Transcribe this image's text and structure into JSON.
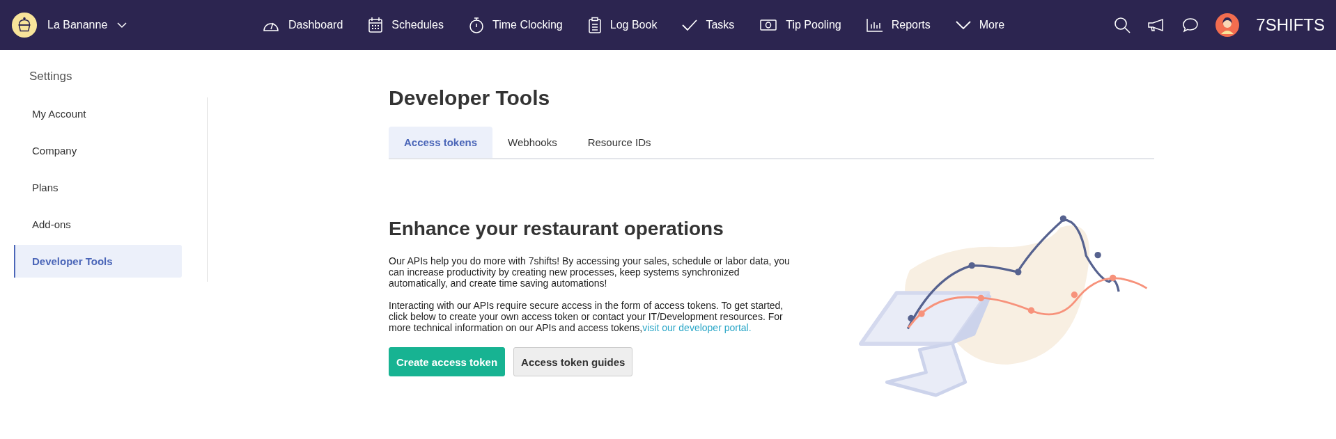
{
  "top_bar": {
    "location": "La Bananne",
    "nav": [
      {
        "label": "Dashboard"
      },
      {
        "label": "Schedules"
      },
      {
        "label": "Time Clocking"
      },
      {
        "label": "Log Book"
      },
      {
        "label": "Tasks"
      },
      {
        "label": "Tip Pooling"
      },
      {
        "label": "Reports"
      },
      {
        "label": "More"
      }
    ],
    "logo": "7SHIFTS"
  },
  "sidebar": {
    "title": "Settings",
    "items": [
      {
        "label": "My Account",
        "selected": false
      },
      {
        "label": "Company",
        "selected": false
      },
      {
        "label": "Plans",
        "selected": false
      },
      {
        "label": "Add-ons",
        "selected": false
      },
      {
        "label": "Developer Tools",
        "selected": true
      }
    ]
  },
  "page": {
    "title": "Developer Tools",
    "tabs": [
      {
        "label": "Access tokens",
        "selected": true
      },
      {
        "label": "Webhooks",
        "selected": false
      },
      {
        "label": "Resource IDs",
        "selected": false
      }
    ],
    "heading": "Enhance your restaurant operations",
    "paragraphs": [
      {
        "text": "Our APIs help you do more with 7shifts! By accessing your sales, schedule or labor data, you can increase productivity by creating new processes, keep systems synchronized automatically, and create time saving automations!"
      },
      {
        "text": "Interacting with our APIs require secure access in the form of access tokens. To get started, click below to create your own access token or contact your IT/Development resources. For more technical information on our APIs and access tokens,",
        "link": "visit our developer portal."
      }
    ],
    "buttons": [
      {
        "label": "Create access token",
        "kind": "primary"
      },
      {
        "label": "Access token guides",
        "kind": "secondary"
      }
    ]
  }
}
